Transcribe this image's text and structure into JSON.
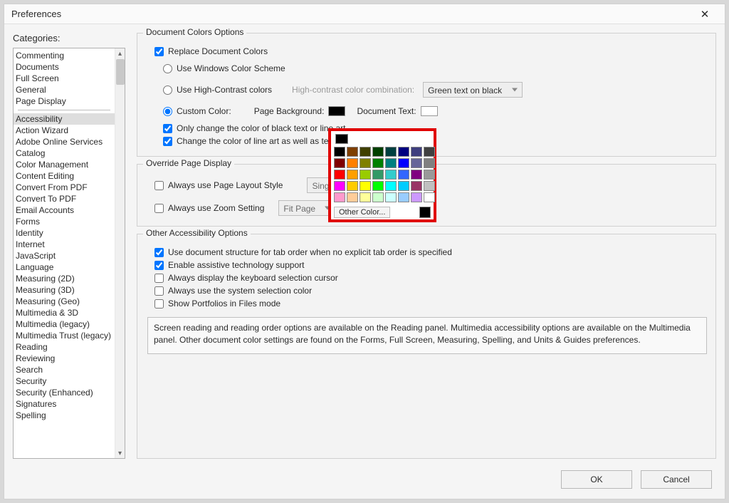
{
  "window": {
    "title": "Preferences"
  },
  "sidebar": {
    "label": "Categories:",
    "topItems": [
      "Commenting",
      "Documents",
      "Full Screen",
      "General",
      "Page Display"
    ],
    "items": [
      "Accessibility",
      "Action Wizard",
      "Adobe Online Services",
      "Catalog",
      "Color Management",
      "Content Editing",
      "Convert From PDF",
      "Convert To PDF",
      "Email Accounts",
      "Forms",
      "Identity",
      "Internet",
      "JavaScript",
      "Language",
      "Measuring (2D)",
      "Measuring (3D)",
      "Measuring (Geo)",
      "Multimedia & 3D",
      "Multimedia (legacy)",
      "Multimedia Trust (legacy)",
      "Reading",
      "Reviewing",
      "Search",
      "Security",
      "Security (Enhanced)",
      "Signatures",
      "Spelling"
    ],
    "selected": "Accessibility"
  },
  "groups": {
    "colors": {
      "title": "Document Colors Options",
      "replaceDocColors": "Replace Document Colors",
      "useWindows": "Use Windows Color Scheme",
      "useHighContrast": "Use High-Contrast colors",
      "highContrastLabel": "High-contrast color combination:",
      "highContrastValue": "Green text on black",
      "customColor": "Custom Color:",
      "pageBackground": "Page Background:",
      "documentText": "Document Text:",
      "onlyBlack": "Only change the color of black text or line art",
      "changeLineArt": "Change the color of line art as well as text"
    },
    "override": {
      "title": "Override Page Display",
      "pageLayout": "Always use Page Layout Style",
      "pageLayoutValue": "Single Page",
      "zoom": "Always use Zoom Setting",
      "zoomValue": "Fit Page"
    },
    "other": {
      "title": "Other Accessibility Options",
      "tabOrder": "Use document structure for tab order when no explicit tab order is specified",
      "assistive": "Enable assistive technology support",
      "cursor": "Always display the keyboard selection cursor",
      "systemSelection": "Always use the system selection color",
      "portfolios": "Show Portfolios in Files mode",
      "info": "Screen reading and reading order options are available on the Reading panel. Multimedia accessibility options are available on the Multimedia panel. Other document color settings are found on the Forms, Full Screen, Measuring, Spelling, and Units & Guides preferences."
    }
  },
  "picker": {
    "otherColor": "Other Color...",
    "grid": [
      [
        "#000000",
        "#7f3f00",
        "#404000",
        "#004000",
        "#004040",
        "#000080",
        "#3f3f7f",
        "#404040"
      ],
      [
        "#800000",
        "#ff7f00",
        "#808000",
        "#008000",
        "#008080",
        "#0000ff",
        "#666699",
        "#808080"
      ],
      [
        "#ff0000",
        "#ff9f00",
        "#99cc00",
        "#339966",
        "#33cccc",
        "#3366ff",
        "#800080",
        "#999999"
      ],
      [
        "#ff00ff",
        "#ffcc00",
        "#ffff00",
        "#00ff00",
        "#00ffff",
        "#00ccff",
        "#993366",
        "#c0c0c0"
      ],
      [
        "#ff99cc",
        "#ffcc99",
        "#ffff99",
        "#ccffcc",
        "#ccffff",
        "#99ccff",
        "#cc99ff",
        "#ffffff"
      ]
    ]
  },
  "footer": {
    "ok": "OK",
    "cancel": "Cancel"
  }
}
